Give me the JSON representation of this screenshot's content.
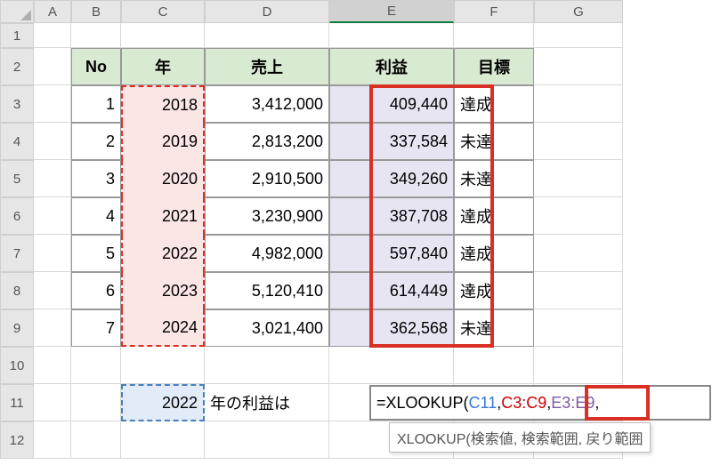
{
  "cols": [
    "A",
    "B",
    "C",
    "D",
    "E",
    "F",
    "G"
  ],
  "rows": [
    "1",
    "2",
    "3",
    "4",
    "5",
    "6",
    "7",
    "8",
    "9",
    "10",
    "11",
    "12"
  ],
  "headers": {
    "no": "No",
    "year": "年",
    "sales": "売上",
    "profit": "利益",
    "target": "目標"
  },
  "data": [
    {
      "no": "1",
      "year": "2018",
      "sales": "3,412,000",
      "profit": "409,440",
      "target": "達成"
    },
    {
      "no": "2",
      "year": "2019",
      "sales": "2,813,200",
      "profit": "337,584",
      "target": "未達"
    },
    {
      "no": "3",
      "year": "2020",
      "sales": "2,910,500",
      "profit": "349,260",
      "target": "未達"
    },
    {
      "no": "4",
      "year": "2021",
      "sales": "3,230,900",
      "profit": "387,708",
      "target": "達成"
    },
    {
      "no": "5",
      "year": "2022",
      "sales": "4,982,000",
      "profit": "597,840",
      "target": "達成"
    },
    {
      "no": "6",
      "year": "2023",
      "sales": "5,120,410",
      "profit": "614,449",
      "target": "達成"
    },
    {
      "no": "7",
      "year": "2024",
      "sales": "3,021,400",
      "profit": "362,568",
      "target": "未達"
    }
  ],
  "c11": "2022",
  "d11": "年の利益は",
  "formula": {
    "eq": "=XLOOKUP(",
    "arg1": "C11",
    "sep1": ",",
    "arg2": "C3:C9",
    "sep2": ",",
    "arg3": "E3:E9",
    "sep3": ","
  },
  "hint": "XLOOKUP(検索値, 検索範囲, 戻り範囲"
}
